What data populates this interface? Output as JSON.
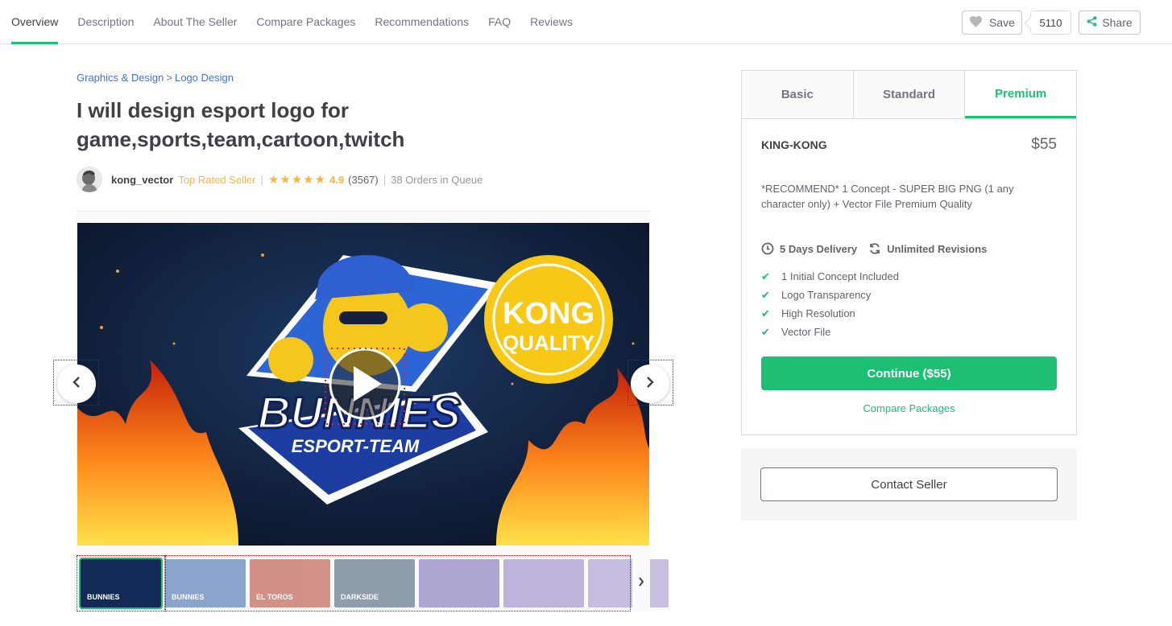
{
  "nav": {
    "tabs": [
      "Overview",
      "Description",
      "About The Seller",
      "Compare Packages",
      "Recommendations",
      "FAQ",
      "Reviews"
    ],
    "active_tab": "Overview",
    "save_label": "Save",
    "save_count": "5110",
    "share_label": "Share"
  },
  "breadcrumb": {
    "category": "Graphics & Design",
    "separator": ">",
    "subcategory": "Logo Design"
  },
  "gig": {
    "title": "I will design esport logo for game,sports,team,cartoon,twitch"
  },
  "seller": {
    "username": "kong_vector",
    "level": "Top Rated Seller",
    "stars": "★★★★★",
    "rating": "4.9",
    "reviews": "(3567)",
    "queue": "38 Orders in Queue",
    "separator": "|"
  },
  "gallery": {
    "hero": {
      "badge_top": "KONG",
      "badge_bottom": "QUALITY",
      "logo_main": "BUNNIES",
      "logo_sub": "ESPORT-TEAM"
    },
    "thumbnails": [
      "BUNNIES",
      "BUNNIES",
      "EL TOROS",
      "DARKSIDE",
      "",
      "",
      ""
    ],
    "active_thumbnail": 0
  },
  "package": {
    "tabs": [
      "Basic",
      "Standard",
      "Premium"
    ],
    "active_tab": "Premium",
    "name": "KING-KONG",
    "price": "$55",
    "description": "*RECOMMEND* 1 Concept - SUPER BIG PNG (1 any character only) + Vector File Premium Quality",
    "delivery": "5 Days Delivery",
    "revisions": "Unlimited Revisions",
    "features": [
      "1 Initial Concept Included",
      "Logo Transparency",
      "High Resolution",
      "Vector File"
    ],
    "continue_label": "Continue ($55)",
    "compare_label": "Compare Packages"
  },
  "contact": {
    "label": "Contact Seller"
  },
  "colors": {
    "brand_green": "#1dbf73",
    "star_gold": "#ffb33e",
    "link_blue": "#446ee7"
  }
}
